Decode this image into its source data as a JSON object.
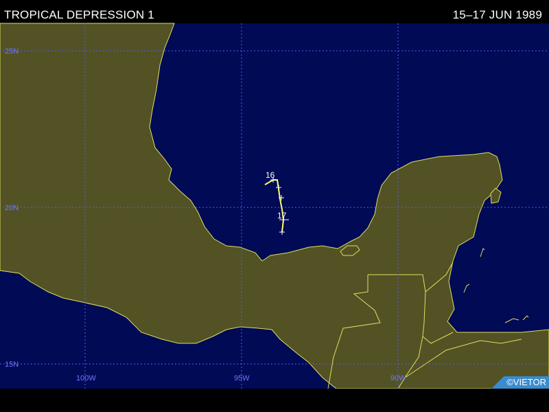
{
  "header": {
    "title": "TROPICAL DEPRESSION 1",
    "dates": "15–17 JUN 1989"
  },
  "map": {
    "colors": {
      "ocean": "#000a55",
      "land": "#525225",
      "coast": "#e0e060",
      "grid": "#5a5aff",
      "track": "#ffff66",
      "markers": "#ffffff"
    },
    "lat_labels": [
      "25N",
      "20N",
      "15N"
    ],
    "lon_labels": [
      "100W",
      "95W",
      "90W"
    ],
    "track_day_labels": [
      "16",
      "17"
    ]
  },
  "credit": "©VIETOR"
}
